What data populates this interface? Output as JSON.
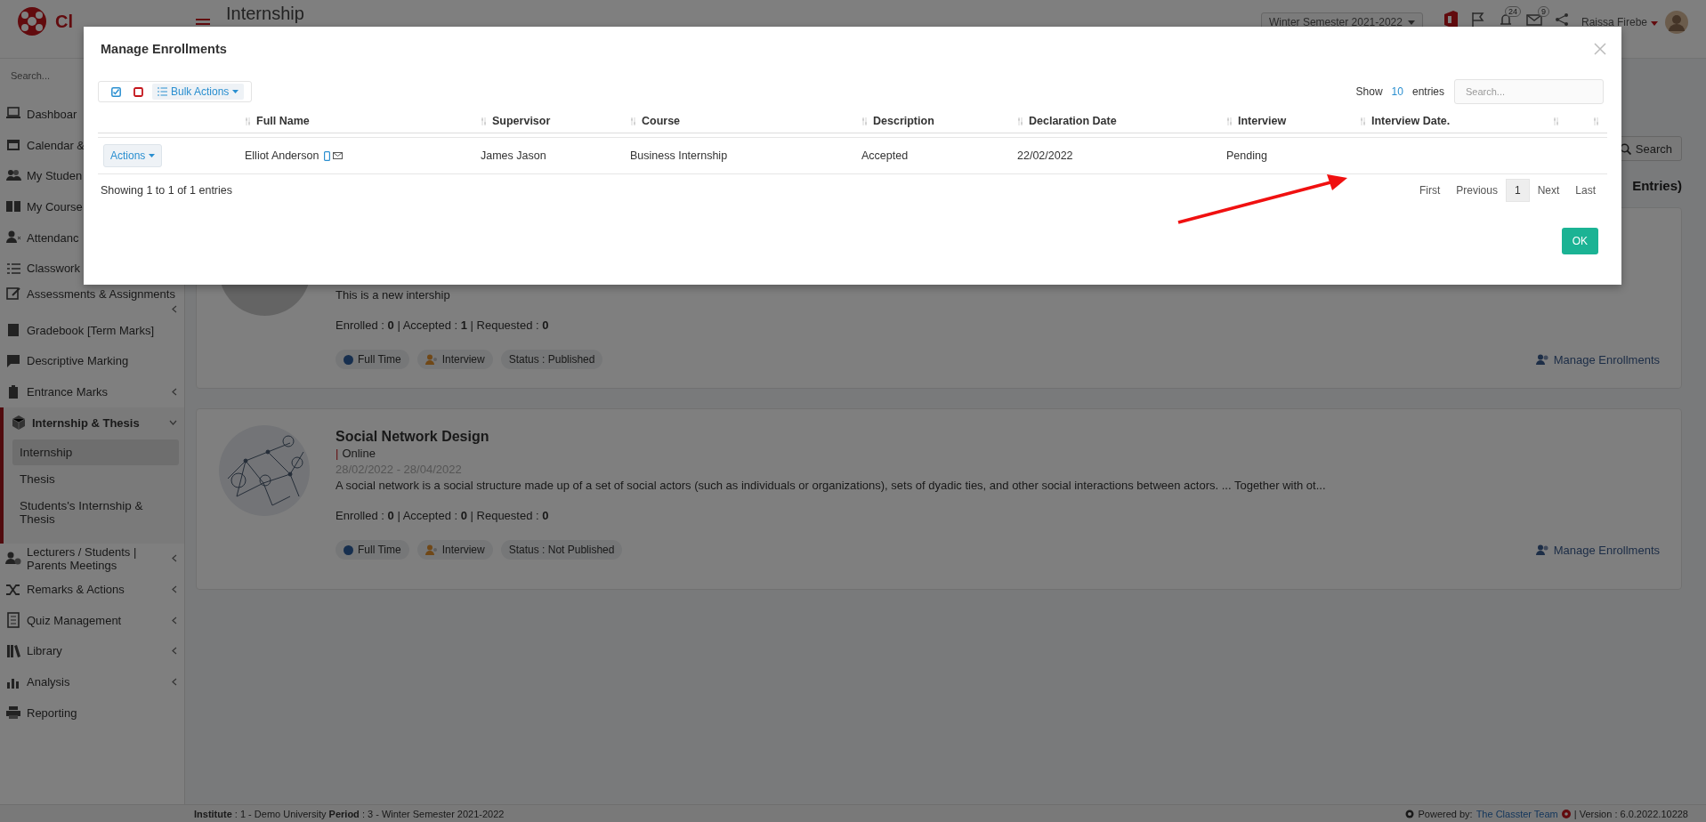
{
  "header": {
    "logo_text": "Cl",
    "page_title": "Internship",
    "period_select": "Winter Semester 2021-2022",
    "notifications": [
      {
        "count": "24"
      },
      {
        "count": "9"
      }
    ],
    "user_name": "Raissa Firebe"
  },
  "sidebar": {
    "search_placeholder": "Search...",
    "items": [
      {
        "kind": "link",
        "label": "Dashboar"
      },
      {
        "kind": "link",
        "label": "Calendar &"
      },
      {
        "kind": "link",
        "label": "My Studen"
      },
      {
        "kind": "link",
        "label": "My Course"
      },
      {
        "kind": "link",
        "label": "Attendanc"
      },
      {
        "kind": "link",
        "label": "Classwork"
      },
      {
        "kind": "group",
        "label": "Assessments & Assignments",
        "expanded": false
      },
      {
        "kind": "link",
        "label": "Gradebook [Term Marks]"
      },
      {
        "kind": "link",
        "label": "Descriptive Marking"
      },
      {
        "kind": "group",
        "label": "Entrance Marks",
        "expanded": false
      },
      {
        "kind": "group",
        "label": "Internship & Thesis",
        "expanded": true,
        "children": [
          {
            "label": "Internship",
            "selected": true
          },
          {
            "label": "Thesis",
            "selected": false
          },
          {
            "label": "Students's Internship & Thesis",
            "selected": false
          }
        ]
      },
      {
        "kind": "group",
        "label": "Lecturers / Students | Parents Meetings",
        "expanded": false
      },
      {
        "kind": "group",
        "label": "Remarks & Actions",
        "expanded": false
      },
      {
        "kind": "group",
        "label": "Quiz Management",
        "expanded": false
      },
      {
        "kind": "group",
        "label": "Library",
        "expanded": false
      },
      {
        "kind": "group",
        "label": "Analysis",
        "expanded": false
      },
      {
        "kind": "link",
        "label": "Reporting"
      }
    ]
  },
  "main": {
    "search_button": "Search",
    "results_heading": "Entries)",
    "courses": [
      {
        "description": "This is a new intership",
        "stats": "Enrolled : **0** | Accepted : **1** | Requested : **0**",
        "tags": [
          {
            "kind": "schedule",
            "label": "Full Time"
          },
          {
            "kind": "interview",
            "label": "Interview"
          },
          {
            "kind": "status",
            "label": "Status : Published"
          }
        ],
        "manage_link": "Manage Enrollments"
      },
      {
        "title": "Social Network Design",
        "mode_bar": "|",
        "mode": "Online",
        "dates": "28/02/2022 - 28/04/2022",
        "description": "A social network is a social structure made up of a set of social actors (such as individuals or organizations), sets of dyadic ties, and other social interactions between actors. ... Together with ot...",
        "stats": "Enrolled : **0** | Accepted : **0** | Requested : **0**",
        "tags": [
          {
            "kind": "schedule",
            "label": "Full Time"
          },
          {
            "kind": "interview",
            "label": "Interview"
          },
          {
            "kind": "status",
            "label": "Status : Not Published"
          }
        ],
        "manage_link": "Manage Enrollments"
      }
    ]
  },
  "modal": {
    "title": "Manage Enrollments",
    "bulk_actions": "Bulk Actions",
    "show_label": "Show",
    "page_size": "10",
    "entries_label": "entries",
    "search_placeholder": "Search...",
    "columns": [
      {
        "sortable": false
      },
      {
        "label": "Full Name",
        "sortable": true
      },
      {
        "label": "Supervisor",
        "sortable": true
      },
      {
        "label": "Course",
        "sortable": true
      },
      {
        "label": "Description",
        "sortable": true
      },
      {
        "label": "Declaration Date",
        "sortable": true
      },
      {
        "label": "Interview",
        "sortable": true
      },
      {
        "label": "Interview Date.",
        "sortable": true
      },
      {
        "sortable": true
      },
      {
        "sortable": true
      }
    ],
    "rows": [
      {
        "cells": [
          "Actions",
          "Elliot Anderson",
          "James Jason",
          "Business Internship",
          "Accepted",
          "22/02/2022",
          "Pending"
        ]
      }
    ],
    "info": "Showing 1 to 1 of 1 entries",
    "pagination": [
      {
        "label": "First",
        "selected": false
      },
      {
        "label": "Previous",
        "selected": false
      },
      {
        "label": "1",
        "selected": true
      },
      {
        "label": "Next",
        "selected": false
      },
      {
        "label": "Last",
        "selected": false
      }
    ],
    "ok_button": "OK"
  },
  "footer": {
    "left": "**Institute** : 1 - Demo University **Period** : 3 - Winter Semester 2021-2022",
    "powered_by": "Powered by:",
    "team_link": "The Classter Team",
    "version": "| Version : 6.0.2022.10228"
  }
}
